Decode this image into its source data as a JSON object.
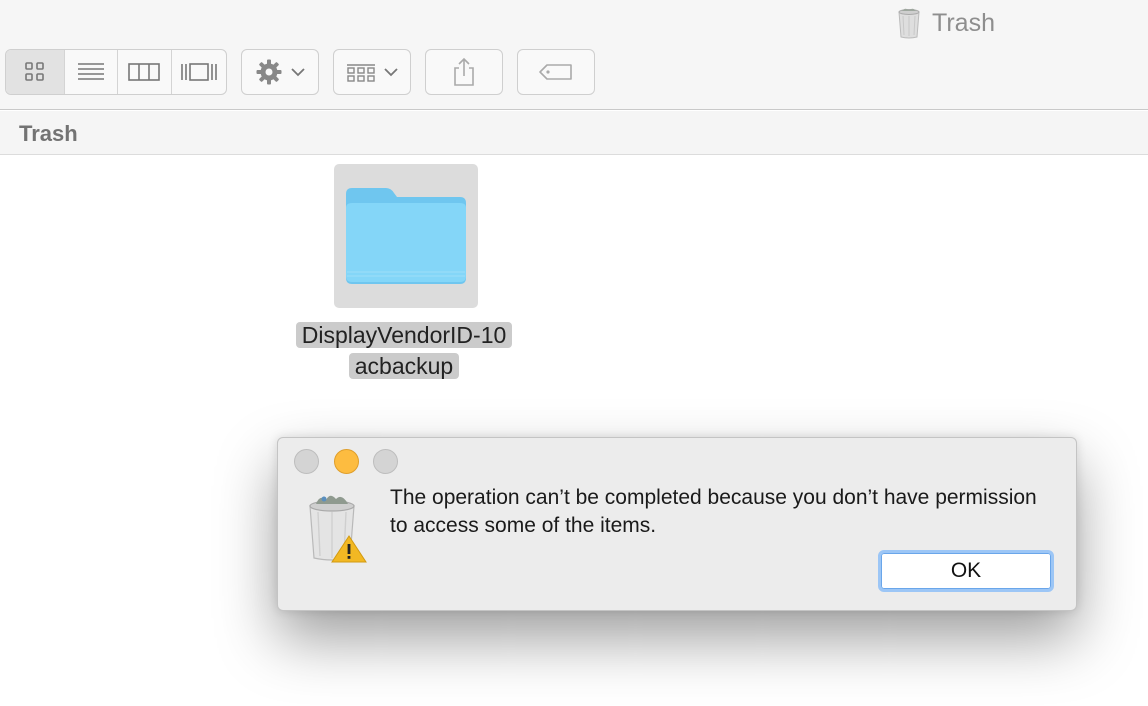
{
  "window": {
    "title": "Trash"
  },
  "toolbar": {
    "view_modes": [
      {
        "icon": "icon-view-icon",
        "active": true
      },
      {
        "icon": "list-view-icon",
        "active": false
      },
      {
        "icon": "column-view-icon",
        "active": false
      },
      {
        "icon": "cover-flow-view-icon",
        "active": false
      }
    ],
    "action_icon": "gear-icon",
    "arrange_icon": "arrange-grid-icon",
    "share_icon": "share-icon",
    "tag_icon": "tag-icon"
  },
  "pathbar": {
    "title": "Trash"
  },
  "content": {
    "items": [
      {
        "name_line1": "DisplayVendorID-10",
        "name_line2": "acbackup",
        "kind": "folder",
        "selected": true
      }
    ]
  },
  "dialog": {
    "message": "The operation can’t be completed because you don’t have permission to access some of the items.",
    "ok_label": "OK",
    "icon": "trash-warning-icon"
  },
  "colors": {
    "folder": "#7fd3f7",
    "minimize": "#fdbc40",
    "focus_ring": "#9cc6f6",
    "warning": "#f2b823"
  }
}
